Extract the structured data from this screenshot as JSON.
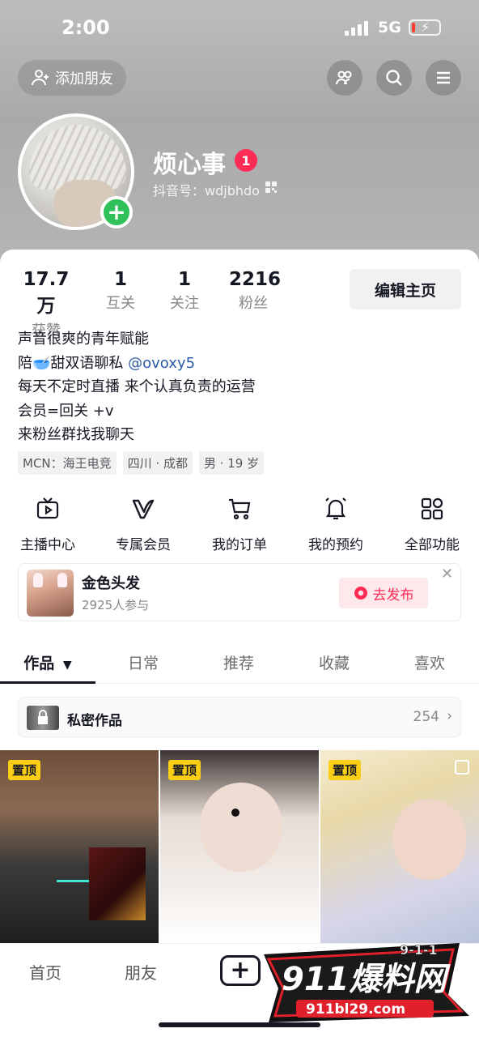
{
  "status_bar": {
    "time": "2:00",
    "network": "5G"
  },
  "header": {
    "add_friend_label": "添加朋友",
    "username": "烦心事",
    "notification_count": "1",
    "douyin_id": "抖音号：wdjbhdo"
  },
  "stats": [
    {
      "value": "17.7万",
      "label": "获赞"
    },
    {
      "value": "1",
      "label": "互关"
    },
    {
      "value": "1",
      "label": "关注"
    },
    {
      "value": "2216",
      "label": "粉丝"
    }
  ],
  "edit_profile_label": "编辑主页",
  "bio": {
    "line1": "声音很爽的青年赋能",
    "line2_prefix": "陪🥣甜双语聊私 ",
    "line2_mention": "@ovoxy5",
    "line3": "每天不定时直播 来个认真负责的运营",
    "line4": "会员=回关 +v",
    "line5": "来粉丝群找我聊天"
  },
  "tags": [
    "MCN：海王电竞",
    "四川 · 成都",
    "男 · 19 岁"
  ],
  "quick_actions": [
    {
      "label": "主播中心",
      "icon": "tv-icon"
    },
    {
      "label": "专属会员",
      "icon": "v-icon"
    },
    {
      "label": "我的订单",
      "icon": "cart-icon"
    },
    {
      "label": "我的预约",
      "icon": "bell-icon"
    },
    {
      "label": "全部功能",
      "icon": "grid-icon"
    }
  ],
  "event": {
    "title": "金色头发",
    "participants": "2925人参与",
    "publish_label": "去发布"
  },
  "tabs": [
    "作品",
    "日常",
    "推荐",
    "收藏",
    "喜欢"
  ],
  "active_tab": "作品",
  "private_works": {
    "label": "私密作品",
    "count": "254"
  },
  "videos": [
    {
      "pinned_label": "置顶"
    },
    {
      "pinned_label": "置顶"
    },
    {
      "pinned_label": "置顶"
    }
  ],
  "bottom_nav": {
    "home": "首页",
    "friends": "朋友"
  },
  "watermark": {
    "brand": "911爆料网",
    "url": "911bl29.com",
    "badge": "9-1-1"
  },
  "colors": {
    "accent": "#fe2c55",
    "pin": "#face15",
    "add_badge": "#2fc25b",
    "mention": "#2b5aa6"
  }
}
